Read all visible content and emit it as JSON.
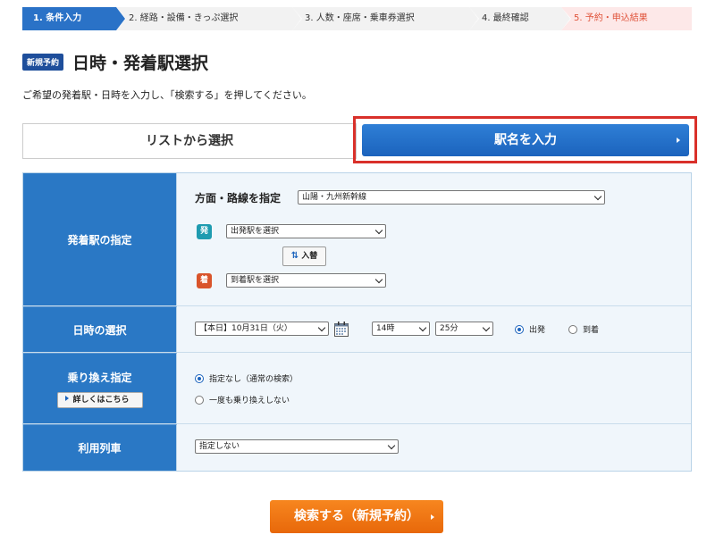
{
  "steps": [
    "1. 条件入力",
    "2. 経路・設備・きっぷ選択",
    "3. 人数・座席・乗車券選択",
    "4. 最終確認",
    "5. 予約・申込結果"
  ],
  "header": {
    "badge": "新規予約",
    "title": "日時・発着駅選択",
    "description": "ご希望の発着駅・日時を入力し、「検索する」を押してください。"
  },
  "mode": {
    "list_label": "リストから選択",
    "station_label": "駅名を入力"
  },
  "station_row": {
    "label": "発着駅の指定",
    "direction_label": "方面・路線を指定",
    "direction_value": "山陽・九州新幹線",
    "dep_tag": "発",
    "dep_value": "出発駅を選択",
    "swap_icon": "⇅",
    "swap_label": "入替",
    "arr_tag": "着",
    "arr_value": "到着駅を選択"
  },
  "datetime_row": {
    "label": "日時の選択",
    "date_value": "【本日】10月31日（火）",
    "hour_value": "14時",
    "minute_value": "25分",
    "depart_label": "出発",
    "arrive_label": "到着",
    "selected": "depart"
  },
  "transfer_row": {
    "label": "乗り換え指定",
    "detail_button": "詳しくはこちら",
    "option_none": "指定なし（通常の検索）",
    "option_no_transfer": "一度も乗り換えしない"
  },
  "train_row": {
    "label": "利用列車",
    "value": "指定しない"
  },
  "search_button": "検索する（新規予約）",
  "colors": {
    "primary": "#2a78c5",
    "search": "#f07a15",
    "highlight": "#d9302a"
  }
}
